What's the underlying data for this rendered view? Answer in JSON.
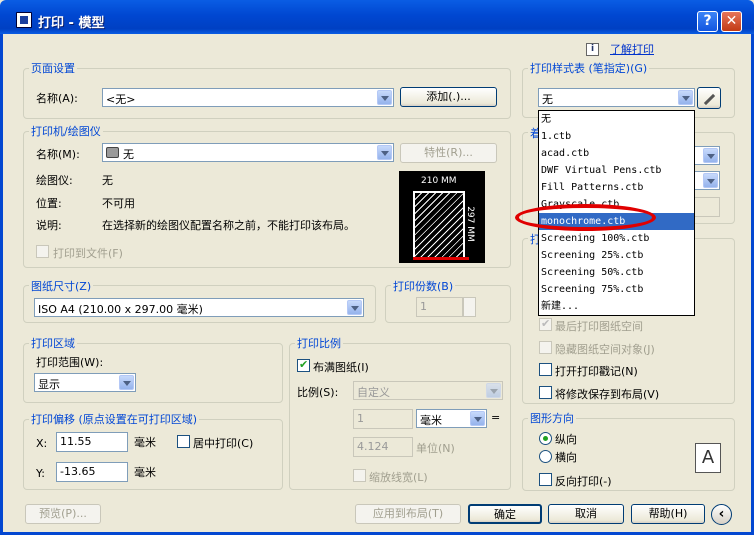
{
  "window": {
    "title": "打印 - 模型",
    "help_glyph": "?",
    "close_glyph": "✕"
  },
  "help_link": "了解打印",
  "page_setup": {
    "title": "页面设置",
    "name_label": "名称(A):",
    "name_value": "<无>",
    "add_button": "添加(.)..."
  },
  "printer": {
    "title": "打印机/绘图仪",
    "name_label": "名称(M):",
    "name_value": "无",
    "props_button": "特性(R)...",
    "plotter_label": "绘图仪:",
    "plotter_value": "无",
    "location_label": "位置:",
    "location_value": "不可用",
    "desc_label": "说明:",
    "desc_value": "在选择新的绘图仪配置名称之前，不能打印该布局。",
    "print_to_file": "打印到文件(F)",
    "preview_width": "210 MM",
    "preview_height": "297 MM"
  },
  "paper_size": {
    "title": "图纸尺寸(Z)",
    "value": "ISO A4 (210.00 x 297.00 毫米)"
  },
  "copies": {
    "title": "打印份数(B)",
    "value": "1"
  },
  "plot_area": {
    "title": "打印区域",
    "range_label": "打印范围(W):",
    "range_value": "显示"
  },
  "plot_offset": {
    "title": "打印偏移 (原点设置在可打印区域)",
    "x_label": "X:",
    "x_value": "11.55",
    "x_unit": "毫米",
    "center_label": "居中打印(C)",
    "y_label": "Y:",
    "y_value": "-13.65",
    "y_unit": "毫米"
  },
  "plot_scale": {
    "title": "打印比例",
    "fit_label": "布满图纸(I)",
    "scale_label": "比例(S):",
    "scale_value": "自定义",
    "num1": "1",
    "unit": "毫米",
    "equals": "=",
    "num2": "4.124",
    "unit_label": "单位(N)",
    "lineweight": "缩放线宽(L)"
  },
  "style_table": {
    "title": "打印样式表 (笔指定)(G)",
    "value": "无",
    "options": [
      "无",
      "1.ctb",
      "acad.ctb",
      "DWF Virtual Pens.ctb",
      "Fill Patterns.ctb",
      "Grayscale.ctb",
      "monochrome.ctb",
      "Screening 100%.ctb",
      "Screening 25%.ctb",
      "Screening 50%.ctb",
      "Screening 75%.ctb",
      "新建..."
    ],
    "selected_index": 6
  },
  "shaded": {
    "title_fragment": "着"
  },
  "options": {
    "title_fragment": "打",
    "last_paper": "最后打印图纸空间",
    "hide_objects": "隐藏图纸空间对象(J)",
    "stamp": "打开打印戳记(N)",
    "save_changes": "将修改保存到布局(V)"
  },
  "orientation": {
    "title": "图形方向",
    "portrait": "纵向",
    "landscape": "横向",
    "reverse": "反向打印(-)",
    "glyph": "A"
  },
  "footer": {
    "preview": "预览(P)...",
    "apply": "应用到布局(T)",
    "ok": "确定",
    "cancel": "取消",
    "help": "帮助(H)",
    "more": "‹"
  }
}
